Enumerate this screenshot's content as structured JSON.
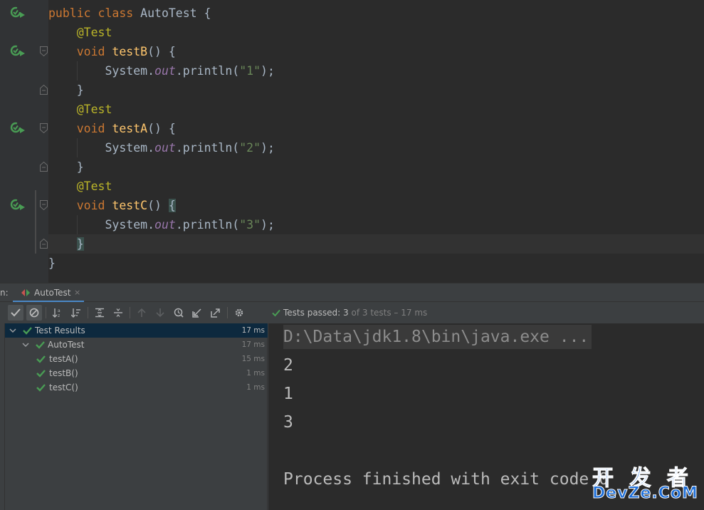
{
  "editor": {
    "lines": [
      [
        {
          "t": "public class ",
          "c": "kw"
        },
        {
          "t": "AutoTest {",
          "c": ""
        }
      ],
      [
        {
          "t": "    ",
          "c": ""
        },
        {
          "t": "@Test",
          "c": "ann"
        }
      ],
      [
        {
          "t": "    ",
          "c": ""
        },
        {
          "t": "void ",
          "c": "kw"
        },
        {
          "t": "testB",
          "c": "fn"
        },
        {
          "t": "() {",
          "c": ""
        }
      ],
      [
        {
          "t": "        System.",
          "c": ""
        },
        {
          "t": "out",
          "c": "fld"
        },
        {
          "t": ".println(",
          "c": ""
        },
        {
          "t": "\"1\"",
          "c": "str"
        },
        {
          "t": ");",
          "c": ""
        }
      ],
      [
        {
          "t": "    }",
          "c": ""
        }
      ],
      [
        {
          "t": "    ",
          "c": ""
        },
        {
          "t": "@Test",
          "c": "ann"
        }
      ],
      [
        {
          "t": "    ",
          "c": ""
        },
        {
          "t": "void ",
          "c": "kw"
        },
        {
          "t": "testA",
          "c": "fn"
        },
        {
          "t": "() {",
          "c": ""
        }
      ],
      [
        {
          "t": "        System.",
          "c": ""
        },
        {
          "t": "out",
          "c": "fld"
        },
        {
          "t": ".println(",
          "c": ""
        },
        {
          "t": "\"2\"",
          "c": "str"
        },
        {
          "t": ");",
          "c": ""
        }
      ],
      [
        {
          "t": "    }",
          "c": ""
        }
      ],
      [
        {
          "t": "    ",
          "c": ""
        },
        {
          "t": "@Test",
          "c": "ann"
        }
      ],
      [
        {
          "t": "    ",
          "c": ""
        },
        {
          "t": "void ",
          "c": "kw"
        },
        {
          "t": "testC",
          "c": "fn"
        },
        {
          "t": "() ",
          "c": ""
        },
        {
          "t": "{",
          "c": "brace-match"
        }
      ],
      [
        {
          "t": "        System.",
          "c": ""
        },
        {
          "t": "out",
          "c": "fld"
        },
        {
          "t": ".println(",
          "c": ""
        },
        {
          "t": "\"3\"",
          "c": "str"
        },
        {
          "t": ");",
          "c": ""
        }
      ],
      [
        {
          "t": "    ",
          "c": ""
        },
        {
          "t": "}",
          "c": "brace-match"
        }
      ],
      [
        {
          "t": "}",
          "c": ""
        }
      ]
    ],
    "run_gutter_lines": [
      0,
      2,
      6,
      10
    ],
    "fold_open_lines": [
      2,
      6,
      10
    ],
    "fold_close_lines": [
      4,
      8,
      12
    ],
    "caret_line": 12
  },
  "run_panel": {
    "title_prefix": "n:",
    "tab_label": "AutoTest",
    "tab_close": "×",
    "status": {
      "passed_label": "Tests passed: ",
      "passed_count": "3",
      "of_text": " of 3 tests – 17 ms"
    },
    "toolbar_icons": [
      "show-passed-icon",
      "show-ignored-icon",
      "sort-alphabetically-icon",
      "sort-by-duration-icon",
      "expand-all-icon",
      "collapse-all-icon",
      "previous-failed-icon",
      "next-failed-icon",
      "test-history-icon",
      "import-tests-icon",
      "export-tests-icon",
      "settings-icon"
    ]
  },
  "tree": {
    "rows": [
      {
        "label": "Test Results",
        "duration": "17 ms",
        "level": 0,
        "expanded": true,
        "selected": true
      },
      {
        "label": "AutoTest",
        "duration": "17 ms",
        "level": 1,
        "expanded": true,
        "selected": false
      },
      {
        "label": "testA()",
        "duration": "15 ms",
        "level": 2,
        "selected": false
      },
      {
        "label": "testB()",
        "duration": "1 ms",
        "level": 2,
        "selected": false
      },
      {
        "label": "testC()",
        "duration": "1 ms",
        "level": 2,
        "selected": false
      }
    ]
  },
  "console": {
    "lines": [
      {
        "text": "D:\\Data\\jdk1.8\\bin\\java.exe ...",
        "kind": "cmd"
      },
      {
        "text": "2",
        "kind": "out"
      },
      {
        "text": "1",
        "kind": "out"
      },
      {
        "text": "3",
        "kind": "out"
      },
      {
        "text": "",
        "kind": "out"
      },
      {
        "text": "Process finished with exit code 0",
        "kind": "out"
      }
    ]
  },
  "watermark": {
    "cn": "开 发 者",
    "en": "DevZe.CoM"
  },
  "colors": {
    "accent": "#4a88c7",
    "pass_green": "#499c54",
    "selection": "#0d293e"
  }
}
